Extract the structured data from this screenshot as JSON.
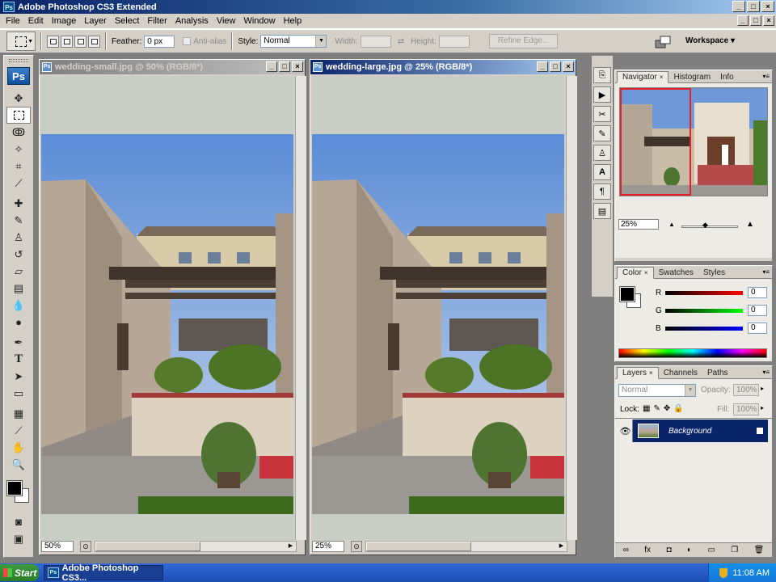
{
  "app": {
    "title": "Adobe Photoshop CS3 Extended",
    "icon_label": "Ps"
  },
  "menu": [
    "File",
    "Edit",
    "Image",
    "Layer",
    "Select",
    "Filter",
    "Analysis",
    "View",
    "Window",
    "Help"
  ],
  "options": {
    "feather_label": "Feather:",
    "feather_value": "0 px",
    "antialias_label": "Anti-alias",
    "style_label": "Style:",
    "style_value": "Normal",
    "width_label": "Width:",
    "height_label": "Height:",
    "refine_edge": "Refine Edge...",
    "workspace": "Workspace ▾"
  },
  "toolbox": {
    "logo": "Ps"
  },
  "documents": [
    {
      "title": "wedding-small.jpg @ 50% (RGB/8*)",
      "zoom": "50%",
      "active": false
    },
    {
      "title": "wedding-large.jpg @ 25% (RGB/8*)",
      "zoom": "25%",
      "active": true
    }
  ],
  "navigator": {
    "tabs": [
      "Navigator",
      "Histogram",
      "Info"
    ],
    "zoom": "25%"
  },
  "color_panel": {
    "tabs": [
      "Color",
      "Swatches",
      "Styles"
    ],
    "channels": [
      {
        "name": "R",
        "value": "0"
      },
      {
        "name": "G",
        "value": "0"
      },
      {
        "name": "B",
        "value": "0"
      }
    ]
  },
  "layers_panel": {
    "tabs": [
      "Layers",
      "Channels",
      "Paths"
    ],
    "blend_mode": "Normal",
    "opacity_label": "Opacity:",
    "opacity_value": "100%",
    "lock_label": "Lock:",
    "fill_label": "Fill:",
    "fill_value": "100%",
    "layer_name": "Background"
  },
  "taskbar": {
    "start": "Start",
    "task": "Adobe Photoshop CS3...",
    "time": "11:08 AM"
  },
  "colors": {
    "accent": "#0a246a",
    "chrome": "#d4d0c8",
    "nav_frame": "#e8202a"
  }
}
